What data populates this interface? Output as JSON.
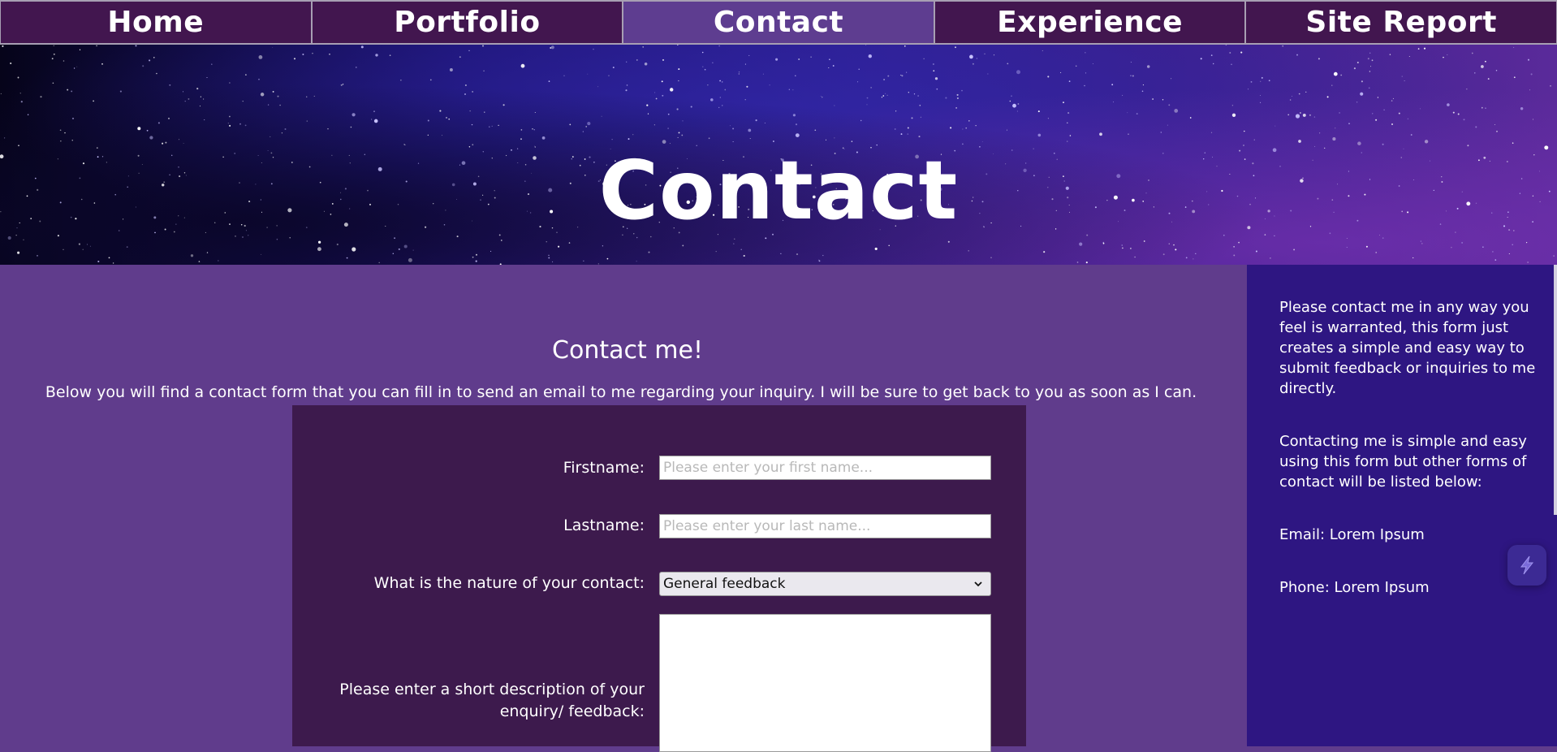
{
  "nav": {
    "items": [
      {
        "label": "Home",
        "active": false
      },
      {
        "label": "Portfolio",
        "active": false
      },
      {
        "label": "Contact",
        "active": true
      },
      {
        "label": "Experience",
        "active": false
      },
      {
        "label": "Site Report",
        "active": false
      }
    ]
  },
  "hero": {
    "title": "Contact"
  },
  "main": {
    "heading": "Contact me!",
    "intro": "Below you will find a contact form that you can fill in to send an email to me regarding your inquiry. I will be sure to get back to you as soon as I can."
  },
  "form": {
    "firstname_label": "Firstname:",
    "firstname_placeholder": "Please enter your first name...",
    "firstname_value": "",
    "lastname_label": "Lastname:",
    "lastname_placeholder": "Please enter your last name...",
    "lastname_value": "",
    "nature_label": "What is the nature of your contact:",
    "nature_selected": "General feedback",
    "description_label": "Please enter a short description of your enquiry/ feedback:",
    "description_value": ""
  },
  "sidebar": {
    "para1": "Please contact me in any way you feel is warranted, this form just creates a simple and easy way to submit feedback or inquiries to me directly.",
    "para2": "Contacting me is simple and easy using this form but other forms of contact will be listed below:",
    "email": "Email: Lorem Ipsum",
    "phone": "Phone: Lorem Ipsum"
  },
  "icons": {
    "floating_button": "lightning-bolt-icon",
    "select_chevron": "chevron-down-icon"
  },
  "colors": {
    "nav_bg": "#42164f",
    "nav_active": "#5e3d90",
    "main_bg": "#603c8c",
    "form_bg": "#3d1a4d",
    "sidebar_bg": "#2e1682"
  }
}
